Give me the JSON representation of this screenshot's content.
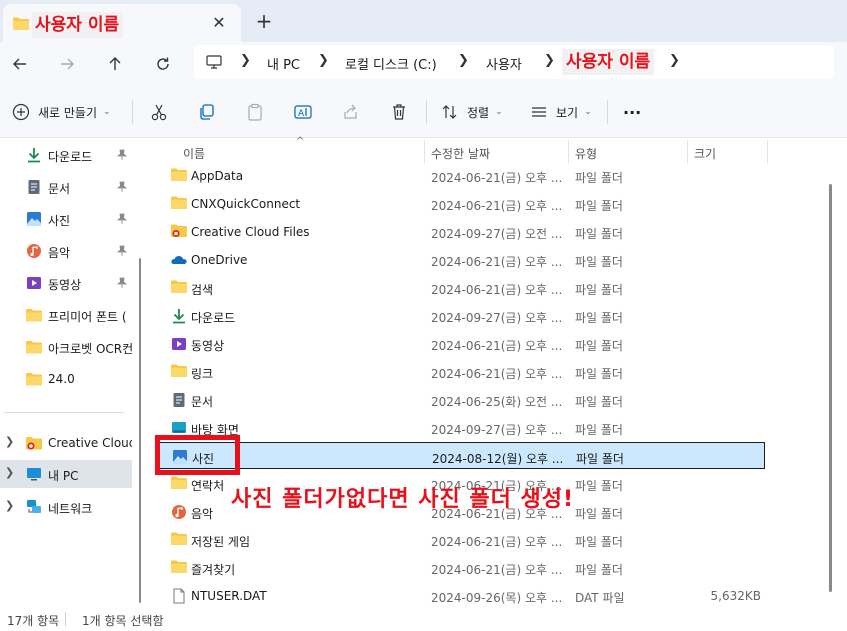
{
  "tab": {
    "title": "사용자 이름",
    "close_icon": "close-icon",
    "new_tab_icon": "plus-icon"
  },
  "nav": {
    "back_icon": "arrow-left-icon",
    "forward_icon": "arrow-right-icon",
    "up_icon": "arrow-up-icon",
    "refresh_icon": "refresh-icon"
  },
  "address": {
    "crumbs": [
      "내 PC",
      "로컬 디스크 (C:)",
      "사용자"
    ],
    "current": "사용자 이름"
  },
  "toolbar": {
    "new_label": "새로 만들기",
    "sort_label": "정렬",
    "view_label": "보기",
    "more_label": "···"
  },
  "sidebar": {
    "quick": [
      {
        "label": "다운로드",
        "icon": "download-icon"
      },
      {
        "label": "문서",
        "icon": "document-icon"
      },
      {
        "label": "사진",
        "icon": "pictures-icon"
      },
      {
        "label": "음악",
        "icon": "music-icon"
      },
      {
        "label": "동영상",
        "icon": "video-icon"
      },
      {
        "label": "프리미어 폰트 (",
        "icon": "folder-icon"
      },
      {
        "label": "아크로벳 OCR컨",
        "icon": "folder-icon"
      },
      {
        "label": "24.0",
        "icon": "folder-icon"
      }
    ],
    "tree": [
      {
        "label": "Creative Cloud",
        "icon": "creative-cloud-icon"
      },
      {
        "label": "내 PC",
        "icon": "pc-icon"
      },
      {
        "label": "네트워크",
        "icon": "network-icon"
      }
    ]
  },
  "columns": {
    "name": "이름",
    "date": "수정한 날짜",
    "type": "유형",
    "size": "크기"
  },
  "files": [
    {
      "name": "AppData",
      "date": "2024-06-21(금) 오후 ...",
      "type": "파일 폴더",
      "size": "",
      "icon": "folder-icon"
    },
    {
      "name": "CNXQuickConnect",
      "date": "2024-06-21(금) 오후 ...",
      "type": "파일 폴더",
      "size": "",
      "icon": "folder-icon"
    },
    {
      "name": "Creative Cloud Files",
      "date": "2024-09-27(금) 오전 ...",
      "type": "파일 폴더",
      "size": "",
      "icon": "creative-cloud-folder-icon"
    },
    {
      "name": "OneDrive",
      "date": "2024-06-21(금) 오후 ...",
      "type": "파일 폴더",
      "size": "",
      "icon": "onedrive-icon"
    },
    {
      "name": "검색",
      "date": "2024-06-21(금) 오후 ...",
      "type": "파일 폴더",
      "size": "",
      "icon": "folder-icon"
    },
    {
      "name": "다운로드",
      "date": "2024-09-27(금) 오후 ...",
      "type": "파일 폴더",
      "size": "",
      "icon": "download-icon"
    },
    {
      "name": "동영상",
      "date": "2024-06-21(금) 오후 ...",
      "type": "파일 폴더",
      "size": "",
      "icon": "video-icon"
    },
    {
      "name": "링크",
      "date": "2024-06-21(금) 오후 ...",
      "type": "파일 폴더",
      "size": "",
      "icon": "folder-icon"
    },
    {
      "name": "문서",
      "date": "2024-06-25(화) 오전 ...",
      "type": "파일 폴더",
      "size": "",
      "icon": "document-icon"
    },
    {
      "name": "바탕 화면",
      "date": "2024-09-27(금) 오후 ...",
      "type": "파일 폴더",
      "size": "",
      "icon": "desktop-icon"
    },
    {
      "name": "사진",
      "date": "2024-08-12(월) 오후 ...",
      "type": "파일 폴더",
      "size": "",
      "icon": "pictures-icon"
    },
    {
      "name": "연락처",
      "date": "2024-06-21(금) 오후 ...",
      "type": "파일 폴더",
      "size": "",
      "icon": "folder-icon"
    },
    {
      "name": "음악",
      "date": "2024-06-21(금) 오후 ...",
      "type": "파일 폴더",
      "size": "",
      "icon": "music-icon"
    },
    {
      "name": "저장된 게임",
      "date": "2024-06-21(금) 오후 ...",
      "type": "파일 폴더",
      "size": "",
      "icon": "folder-icon"
    },
    {
      "name": "즐겨찾기",
      "date": "2024-06-21(금) 오후 ...",
      "type": "파일 폴더",
      "size": "",
      "icon": "folder-icon"
    },
    {
      "name": "NTUSER.DAT",
      "date": "2024-09-26(목) 오후 ...",
      "type": "DAT 파일",
      "size": "5,632KB",
      "icon": "file-icon"
    }
  ],
  "annotation": {
    "text": "사진 폴더가없다면 사진  폴더 생성!"
  },
  "status": {
    "count": "17개 항목",
    "selected": "1개 항목 선택함"
  },
  "colors": {
    "highlight_red": "#e8101b",
    "selection_blue": "#cce8ff",
    "folder_yellow": "#f7c948"
  }
}
